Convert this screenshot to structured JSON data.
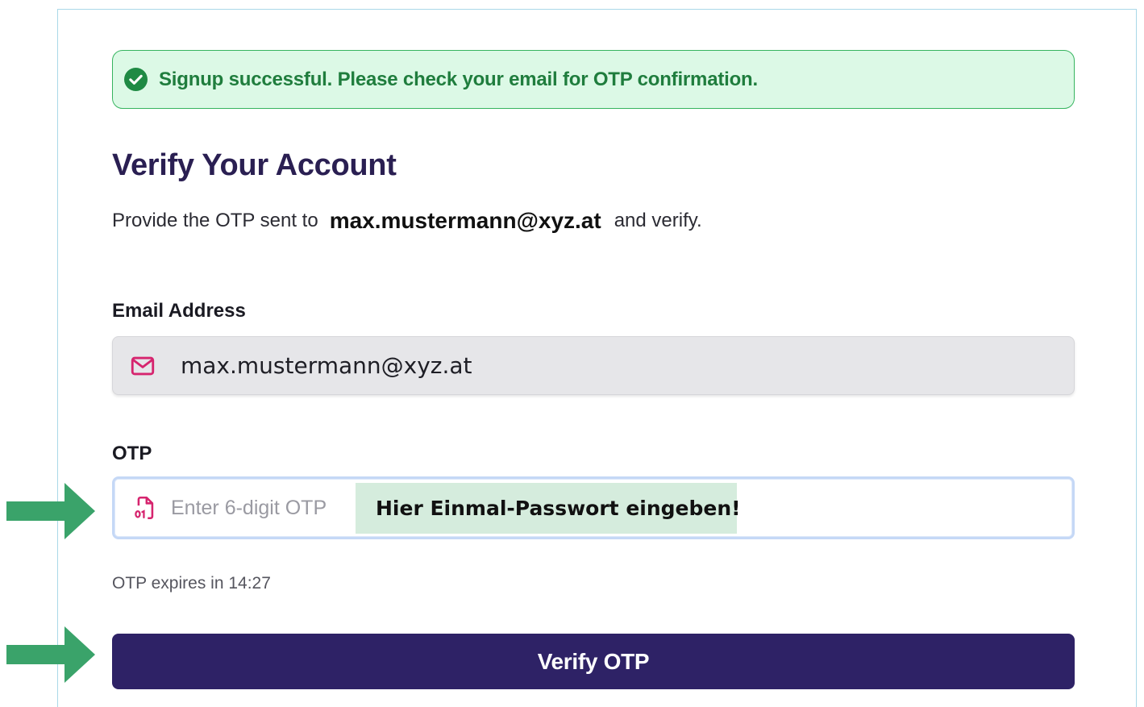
{
  "alert": {
    "message": "Signup successful. Please check your email for OTP confirmation.",
    "icon": "check-circle-icon",
    "color": "#1f7d3d",
    "background": "#dcf9e6"
  },
  "heading": {
    "title": "Verify Your Account",
    "subtitle_prefix": "Provide the OTP sent to",
    "subtitle_email": "max.mustermann@xyz.at",
    "subtitle_suffix": "and verify."
  },
  "email_field": {
    "label": "Email Address",
    "value": "max.mustermann@xyz.at",
    "icon": "mail-icon"
  },
  "otp_field": {
    "label": "OTP",
    "placeholder": "Enter 6-digit OTP",
    "value": "",
    "icon": "binary-file-icon"
  },
  "annotation": {
    "text": "Hier Einmal-Passwort eingeben!",
    "arrow_color": "#3aa36a"
  },
  "expiry": {
    "text": "OTP expires in 14:27"
  },
  "verify_button": {
    "label": "Verify OTP",
    "background": "#2e2266"
  },
  "colors": {
    "accent_pink": "#d6246e",
    "title": "#2a1f52"
  }
}
